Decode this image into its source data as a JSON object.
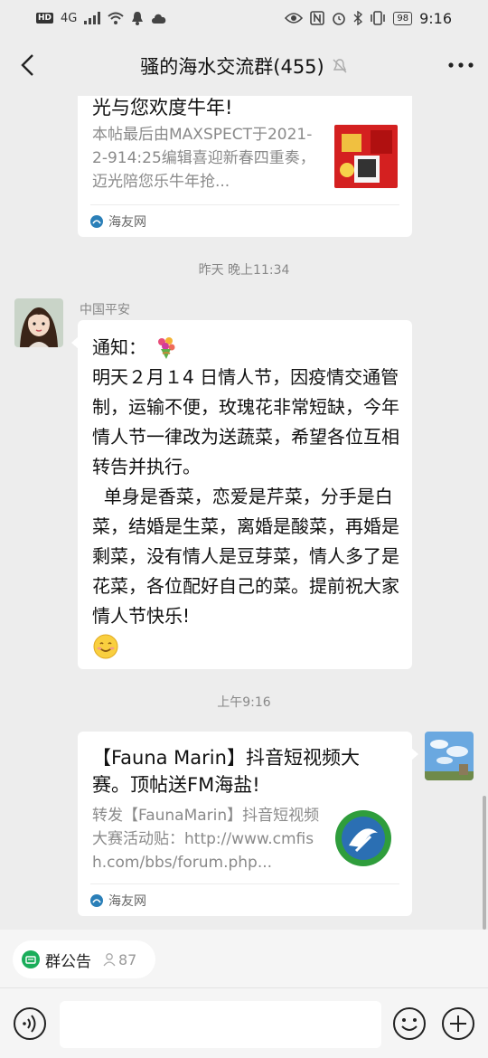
{
  "status_bar": {
    "left_badge": "HD",
    "network": "4G",
    "battery": "98",
    "time": "9:16"
  },
  "header": {
    "title": "骚的海水交流群(455)"
  },
  "messages": {
    "card1": {
      "title": "光与您欢度牛年!",
      "desc": "本帖最后由MAXSPECT于2021-2-914:25编辑喜迎新春四重奏，迈光陪您乐牛年抢...",
      "source": "海友网"
    },
    "timestamp1": "昨天 晚上11:34",
    "notice": {
      "sender": "中国平安",
      "line1": "通知：",
      "para1": "明天２月１4 日情人节，因疫情交通管制，运输不便，玫瑰花非常短缺，今年情人节一律改为送蔬菜，希望各位互相转告并执行。",
      "para2": "  单身是香菜，恋爱是芹菜，分手是白菜，结婚是生菜，离婚是酸菜，再婚是剩菜，没有情人是豆芽菜，情人多了是花菜，各位配好自己的菜。提前祝大家情人节快乐!"
    },
    "timestamp2": "上午9:16",
    "card2": {
      "title": "【Fauna Marin】抖音短视频大赛。顶帖送FM海盐!",
      "desc": "转发【FaunaMarin】抖音短视频大赛活动贴：http://www.cmfish.com/bbs/forum.php...",
      "source": "海友网"
    }
  },
  "bottom": {
    "notice_label": "群公告",
    "member_count": "87"
  }
}
